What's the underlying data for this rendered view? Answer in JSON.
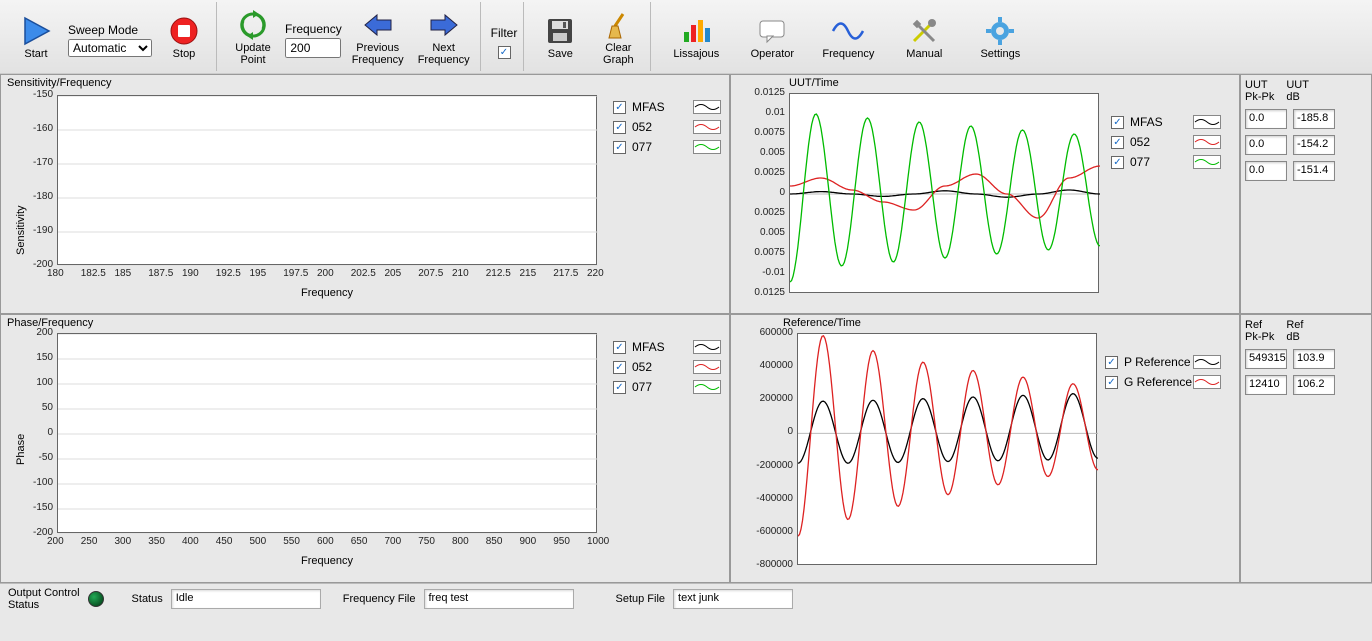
{
  "toolbar": {
    "start": "Start",
    "sweep_mode_label": "Sweep Mode",
    "sweep_mode_value": "Automatic",
    "stop": "Stop",
    "update_point": "Update\nPoint",
    "frequency_label": "Frequency",
    "frequency_value": "200",
    "prev_freq": "Previous\nFrequency",
    "next_freq": "Next\nFrequency",
    "filter_label": "Filter",
    "filter_checked": true,
    "save": "Save",
    "clear_graph": "Clear\nGraph",
    "lissajous": "Lissajous",
    "operator": "Operator",
    "frequency_btn": "Frequency",
    "manual": "Manual",
    "settings": "Settings"
  },
  "panels": {
    "sens_freq": {
      "title": "Sensitivity/Frequency",
      "xlabel": "Frequency",
      "ylabel": "Sensitivity",
      "x_ticks": [
        "180",
        "182.5",
        "185",
        "187.5",
        "190",
        "192.5",
        "195",
        "197.5",
        "200",
        "202.5",
        "205",
        "207.5",
        "210",
        "212.5",
        "215",
        "217.5",
        "220"
      ],
      "y_ticks": [
        "-150",
        "-160",
        "-170",
        "-180",
        "-190",
        "-200"
      ],
      "legend": [
        {
          "name": "MFAS",
          "color": "#000",
          "checked": true
        },
        {
          "name": "052",
          "color": "#d22",
          "checked": true
        },
        {
          "name": "077",
          "color": "#0b0",
          "checked": true
        }
      ]
    },
    "phase_freq": {
      "title": "Phase/Frequency",
      "xlabel": "Frequency",
      "ylabel": "Phase",
      "x_ticks": [
        "200",
        "250",
        "300",
        "350",
        "400",
        "450",
        "500",
        "550",
        "600",
        "650",
        "700",
        "750",
        "800",
        "850",
        "900",
        "950",
        "1000"
      ],
      "y_ticks": [
        "200",
        "150",
        "100",
        "50",
        "0",
        "-50",
        "-100",
        "-150",
        "-200"
      ],
      "legend": [
        {
          "name": "MFAS",
          "color": "#000",
          "checked": true
        },
        {
          "name": "052",
          "color": "#d22",
          "checked": true
        },
        {
          "name": "077",
          "color": "#0b0",
          "checked": true
        }
      ]
    },
    "uut_time": {
      "title": "UUT/Time",
      "y_ticks": [
        "0.0125",
        "0.01",
        "0.0075",
        "0.005",
        "0.0025",
        "0",
        "0.0025",
        "0.005",
        "0.0075",
        "-0.01",
        "0.0125"
      ],
      "legend": [
        {
          "name": "MFAS",
          "color": "#000",
          "checked": true
        },
        {
          "name": "052",
          "color": "#d22",
          "checked": true
        },
        {
          "name": "077",
          "color": "#0b0",
          "checked": true
        }
      ]
    },
    "ref_time": {
      "title": "Reference/Time",
      "y_ticks": [
        "600000",
        "400000",
        "200000",
        "0",
        "-200000",
        "-400000",
        "-600000",
        "-800000"
      ],
      "legend": [
        {
          "name": "P Reference",
          "color": "#000",
          "checked": true
        },
        {
          "name": "G Reference",
          "color": "#d22",
          "checked": true
        }
      ]
    }
  },
  "side": {
    "uut": {
      "hdr1": "UUT\nPk-Pk",
      "hdr2": "UUT\ndB",
      "rows": [
        {
          "pkpk": "0.0",
          "db": "-185.8"
        },
        {
          "pkpk": "0.0",
          "db": "-154.2"
        },
        {
          "pkpk": "0.0",
          "db": "-151.4"
        }
      ]
    },
    "ref": {
      "hdr1": "Ref\nPk-Pk",
      "hdr2": "Ref\ndB",
      "rows": [
        {
          "pkpk": "549315",
          "db": "103.9"
        },
        {
          "pkpk": "12410",
          "db": "106.2"
        }
      ]
    }
  },
  "status": {
    "output_control_label": "Output Control\nStatus",
    "status_label": "Status",
    "status_value": "Idle",
    "freq_file_label": "Frequency File",
    "freq_file_value": "freq test",
    "setup_file_label": "Setup File",
    "setup_file_value": "text junk"
  },
  "chart_data": [
    {
      "type": "line",
      "title": "Sensitivity/Frequency",
      "xlabel": "Frequency",
      "ylabel": "Sensitivity",
      "xlim": [
        180,
        220
      ],
      "ylim": [
        -200,
        -150
      ],
      "series": [
        {
          "name": "MFAS",
          "values": []
        },
        {
          "name": "052",
          "values": []
        },
        {
          "name": "077",
          "values": []
        }
      ]
    },
    {
      "type": "line",
      "title": "Phase/Frequency",
      "xlabel": "Frequency",
      "ylabel": "Phase",
      "xlim": [
        200,
        1000
      ],
      "ylim": [
        -200,
        200
      ],
      "series": [
        {
          "name": "MFAS",
          "values": []
        },
        {
          "name": "052",
          "values": []
        },
        {
          "name": "077",
          "values": []
        }
      ]
    },
    {
      "type": "line",
      "title": "UUT/Time",
      "ylabel": "",
      "ylim": [
        -0.0125,
        0.0125
      ],
      "series": [
        {
          "name": "MFAS",
          "color": "#000",
          "x": [
            0,
            30,
            60,
            90,
            120,
            150,
            180,
            210,
            240,
            270,
            300
          ],
          "values": [
            0,
            0.0003,
            0,
            -0.0003,
            0,
            0.0004,
            0,
            -0.0004,
            0,
            0.0005,
            0
          ]
        },
        {
          "name": "052",
          "color": "#d22",
          "x": [
            0,
            30,
            60,
            90,
            120,
            150,
            180,
            210,
            240,
            270,
            300
          ],
          "values": [
            0.001,
            0.002,
            0.0005,
            -0.001,
            -0.002,
            0.001,
            0.0025,
            0,
            -0.003,
            0.002,
            0.0035
          ]
        },
        {
          "name": "077",
          "color": "#0b0",
          "x": [
            0,
            25,
            50,
            75,
            100,
            125,
            150,
            175,
            200,
            225,
            250,
            275,
            300
          ],
          "values": [
            -0.011,
            0.01,
            -0.009,
            0.0095,
            -0.0085,
            0.009,
            -0.008,
            0.0085,
            -0.0075,
            0.008,
            -0.007,
            0.0075,
            -0.0065
          ]
        }
      ]
    },
    {
      "type": "line",
      "title": "Reference/Time",
      "ylabel": "",
      "ylim": [
        -800000,
        600000
      ],
      "series": [
        {
          "name": "P Reference",
          "color": "#000",
          "x": [
            0,
            25,
            50,
            75,
            100,
            125,
            150,
            175,
            200,
            225,
            250,
            275,
            300
          ],
          "values": [
            -180000,
            195000,
            -180000,
            200000,
            -175000,
            210000,
            -170000,
            220000,
            -165000,
            230000,
            -160000,
            240000,
            -150000
          ]
        },
        {
          "name": "G Reference",
          "color": "#d22",
          "x": [
            0,
            25,
            50,
            75,
            100,
            125,
            150,
            175,
            200,
            225,
            250,
            275,
            300
          ],
          "values": [
            -620000,
            590000,
            -520000,
            500000,
            -440000,
            430000,
            -370000,
            380000,
            -310000,
            340000,
            -260000,
            300000,
            -220000
          ]
        }
      ]
    }
  ]
}
